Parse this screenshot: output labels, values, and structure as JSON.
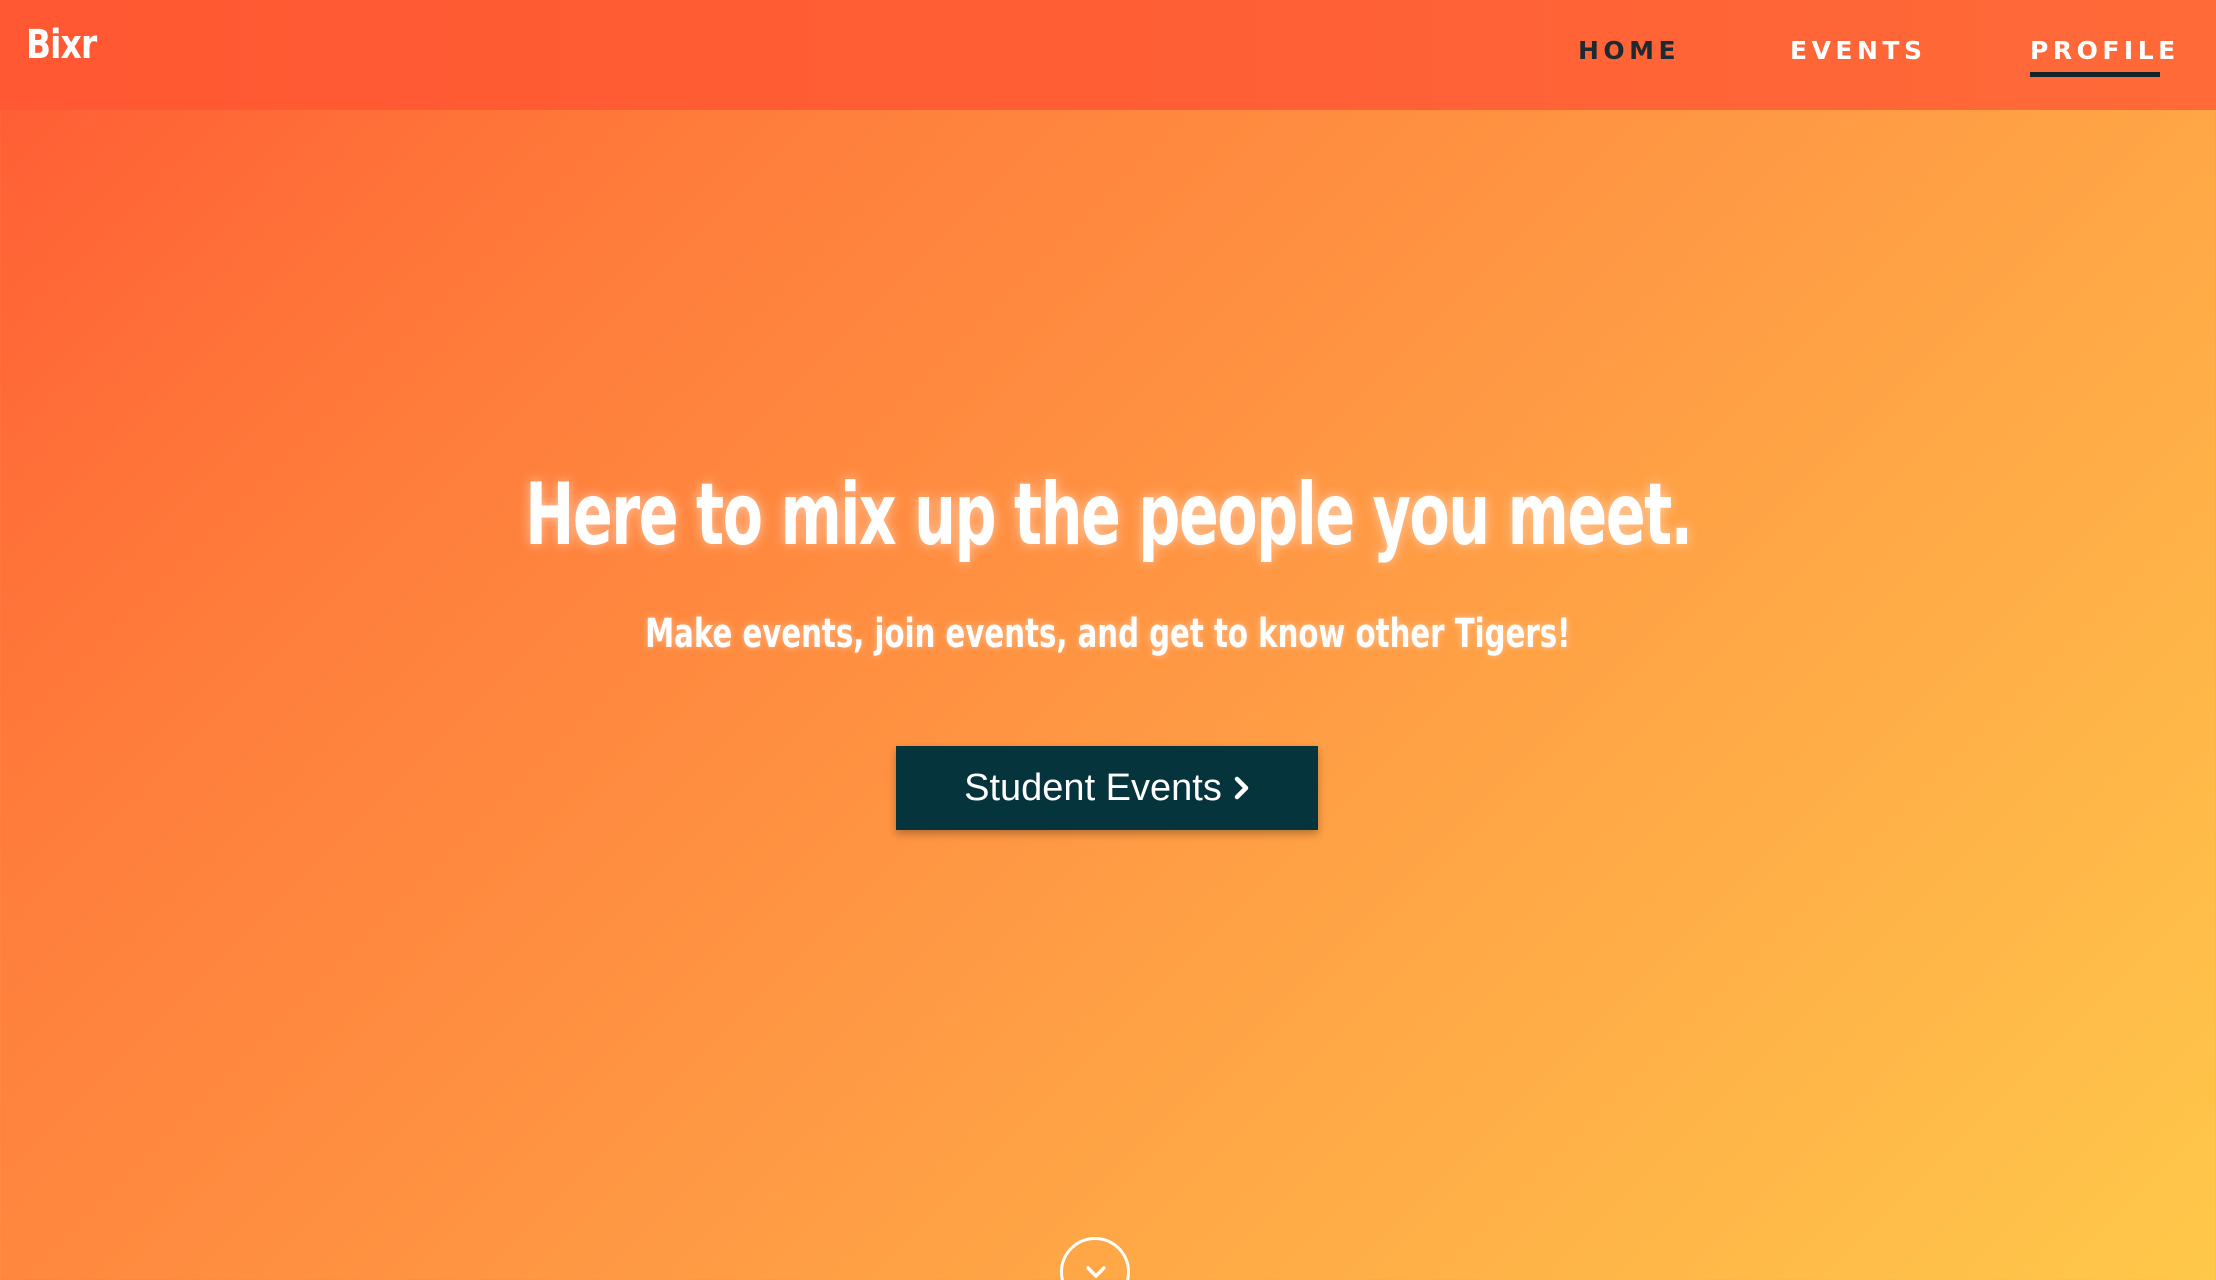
{
  "navbar": {
    "brand": "Bixr",
    "links": [
      {
        "label": "HOME",
        "state": "hover"
      },
      {
        "label": "EVENTS",
        "state": "normal"
      },
      {
        "label": "PROFILE",
        "state": "active"
      }
    ]
  },
  "hero": {
    "title": "Here to mix up the people you meet.",
    "subtitle": "Make events, join events, and get to know other Tigers!",
    "cta": {
      "label": "Student Events",
      "icon": "chevron-right-icon"
    },
    "scroll_button_icon": "chevron-down-icon"
  },
  "colors": {
    "navbar": "#ff5a34",
    "gradient_start": "#ff5a34",
    "gradient_end": "#ffc84a",
    "button": "#06343d",
    "active_underline": "#13252b",
    "hover_link": "#1f2a30"
  }
}
